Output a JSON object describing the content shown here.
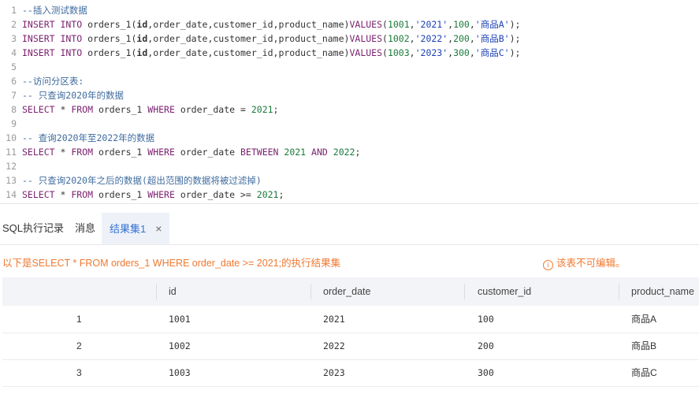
{
  "editor": {
    "lines": [
      {
        "n": "1",
        "parts": [
          {
            "t": "--插入测试数据",
            "c": "cmt"
          }
        ]
      },
      {
        "n": "2",
        "parts": [
          {
            "t": "INSERT INTO",
            "c": "kw"
          },
          {
            "t": " orders_1(",
            "c": ""
          },
          {
            "t": "id",
            "c": "bold"
          },
          {
            "t": ",order_date,customer_id,product_name)",
            "c": ""
          },
          {
            "t": "VALUES",
            "c": "kw"
          },
          {
            "t": "(",
            "c": ""
          },
          {
            "t": "1001",
            "c": "num"
          },
          {
            "t": ",",
            "c": ""
          },
          {
            "t": "'2021'",
            "c": "str"
          },
          {
            "t": ",",
            "c": ""
          },
          {
            "t": "100",
            "c": "num"
          },
          {
            "t": ",",
            "c": ""
          },
          {
            "t": "'商品A'",
            "c": "str"
          },
          {
            "t": ");",
            "c": ""
          }
        ]
      },
      {
        "n": "3",
        "parts": [
          {
            "t": "INSERT INTO",
            "c": "kw"
          },
          {
            "t": " orders_1(",
            "c": ""
          },
          {
            "t": "id",
            "c": "bold"
          },
          {
            "t": ",order_date,customer_id,product_name)",
            "c": ""
          },
          {
            "t": "VALUES",
            "c": "kw"
          },
          {
            "t": "(",
            "c": ""
          },
          {
            "t": "1002",
            "c": "num"
          },
          {
            "t": ",",
            "c": ""
          },
          {
            "t": "'2022'",
            "c": "str"
          },
          {
            "t": ",",
            "c": ""
          },
          {
            "t": "200",
            "c": "num"
          },
          {
            "t": ",",
            "c": ""
          },
          {
            "t": "'商品B'",
            "c": "str"
          },
          {
            "t": ");",
            "c": ""
          }
        ]
      },
      {
        "n": "4",
        "parts": [
          {
            "t": "INSERT INTO",
            "c": "kw"
          },
          {
            "t": " orders_1(",
            "c": ""
          },
          {
            "t": "id",
            "c": "bold"
          },
          {
            "t": ",order_date,customer_id,product_name)",
            "c": ""
          },
          {
            "t": "VALUES",
            "c": "kw"
          },
          {
            "t": "(",
            "c": ""
          },
          {
            "t": "1003",
            "c": "num"
          },
          {
            "t": ",",
            "c": ""
          },
          {
            "t": "'2023'",
            "c": "str"
          },
          {
            "t": ",",
            "c": ""
          },
          {
            "t": "300",
            "c": "num"
          },
          {
            "t": ",",
            "c": ""
          },
          {
            "t": "'商品C'",
            "c": "str"
          },
          {
            "t": ");",
            "c": ""
          }
        ]
      },
      {
        "n": "5",
        "parts": []
      },
      {
        "n": "6",
        "parts": [
          {
            "t": "--访问分区表:",
            "c": "cmt"
          }
        ]
      },
      {
        "n": "7",
        "parts": [
          {
            "t": "-- 只查询2020年的数据",
            "c": "cmt"
          }
        ]
      },
      {
        "n": "8",
        "parts": [
          {
            "t": "SELECT",
            "c": "kw"
          },
          {
            "t": " * ",
            "c": ""
          },
          {
            "t": "FROM",
            "c": "kw"
          },
          {
            "t": " orders_1 ",
            "c": ""
          },
          {
            "t": "WHERE",
            "c": "kw"
          },
          {
            "t": " order_date = ",
            "c": ""
          },
          {
            "t": "2021",
            "c": "num"
          },
          {
            "t": ";",
            "c": ""
          }
        ]
      },
      {
        "n": "9",
        "parts": []
      },
      {
        "n": "10",
        "parts": [
          {
            "t": "-- 查询2020年至2022年的数据",
            "c": "cmt"
          }
        ]
      },
      {
        "n": "11",
        "parts": [
          {
            "t": "SELECT",
            "c": "kw"
          },
          {
            "t": " * ",
            "c": ""
          },
          {
            "t": "FROM",
            "c": "kw"
          },
          {
            "t": " orders_1 ",
            "c": ""
          },
          {
            "t": "WHERE",
            "c": "kw"
          },
          {
            "t": " order_date ",
            "c": ""
          },
          {
            "t": "BETWEEN",
            "c": "kw"
          },
          {
            "t": " ",
            "c": ""
          },
          {
            "t": "2021",
            "c": "num"
          },
          {
            "t": " ",
            "c": ""
          },
          {
            "t": "AND",
            "c": "kw"
          },
          {
            "t": " ",
            "c": ""
          },
          {
            "t": "2022",
            "c": "num"
          },
          {
            "t": ";",
            "c": ""
          }
        ]
      },
      {
        "n": "12",
        "parts": []
      },
      {
        "n": "13",
        "parts": [
          {
            "t": "-- 只查询2020年之后的数据(超出范围的数据将被过滤掉)",
            "c": "cmt"
          }
        ]
      },
      {
        "n": "14",
        "parts": [
          {
            "t": "SELECT",
            "c": "kw"
          },
          {
            "t": " * ",
            "c": ""
          },
          {
            "t": "FROM",
            "c": "kw"
          },
          {
            "t": " orders_1 ",
            "c": ""
          },
          {
            "t": "WHERE",
            "c": "kw"
          },
          {
            "t": " order_date >= ",
            "c": ""
          },
          {
            "t": "2021",
            "c": "num"
          },
          {
            "t": ";",
            "c": ""
          }
        ]
      }
    ]
  },
  "tabs": {
    "sql_log": "SQL执行记录",
    "messages": "消息",
    "result": "结果集1",
    "close": "×"
  },
  "result": {
    "info": "以下是SELECT * FROM orders_1 WHERE order_date >= 2021;的执行结果集",
    "warn_icon": "i",
    "warn": "该表不可编辑。",
    "columns": [
      "id",
      "order_date",
      "customer_id",
      "product_name"
    ],
    "rows": [
      {
        "idx": "1",
        "id": "1001",
        "order_date": "2021",
        "customer_id": "100",
        "product_name": "商品A"
      },
      {
        "idx": "2",
        "id": "1002",
        "order_date": "2022",
        "customer_id": "200",
        "product_name": "商品B"
      },
      {
        "idx": "3",
        "id": "1003",
        "order_date": "2023",
        "customer_id": "300",
        "product_name": "商品C"
      }
    ]
  },
  "colors": {
    "keyword": "#7a1f6e",
    "number": "#1a7a3a",
    "string": "#1a3fb5",
    "comment": "#3f6b9e",
    "accent": "#3572d4",
    "warning": "#f07830"
  }
}
